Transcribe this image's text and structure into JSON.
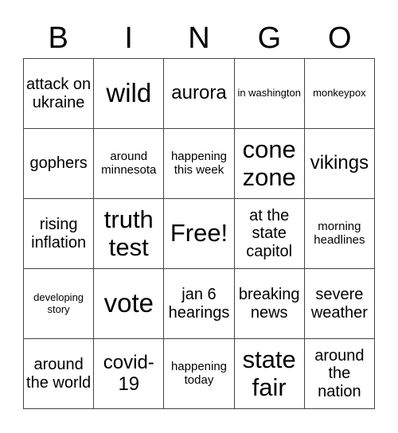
{
  "header": {
    "letters": [
      "B",
      "I",
      "N",
      "G",
      "O"
    ]
  },
  "board": {
    "rows": [
      [
        {
          "text": "attack on ukraine",
          "size": "md"
        },
        {
          "text": "wild",
          "size": "xxl"
        },
        {
          "text": "aurora",
          "size": "lg"
        },
        {
          "text": "in washington",
          "size": "xs"
        },
        {
          "text": "monkeypox",
          "size": "xs"
        }
      ],
      [
        {
          "text": "gophers",
          "size": "md"
        },
        {
          "text": "around minnesota",
          "size": "sm"
        },
        {
          "text": "happening this week",
          "size": "sm"
        },
        {
          "text": "cone zone",
          "size": "xl"
        },
        {
          "text": "vikings",
          "size": "lg"
        }
      ],
      [
        {
          "text": "rising inflation",
          "size": "md"
        },
        {
          "text": "truth test",
          "size": "xl"
        },
        {
          "text": "Free!",
          "size": "xl"
        },
        {
          "text": "at the state capitol",
          "size": "md"
        },
        {
          "text": "morning headlines",
          "size": "sm"
        }
      ],
      [
        {
          "text": "developing story",
          "size": "xs"
        },
        {
          "text": "vote",
          "size": "xxl"
        },
        {
          "text": "jan 6 hearings",
          "size": "md"
        },
        {
          "text": "breaking news",
          "size": "md"
        },
        {
          "text": "severe weather",
          "size": "md"
        }
      ],
      [
        {
          "text": "around the world",
          "size": "md"
        },
        {
          "text": "covid-19",
          "size": "lg"
        },
        {
          "text": "happening today",
          "size": "sm"
        },
        {
          "text": "state fair",
          "size": "xl"
        },
        {
          "text": "around the nation",
          "size": "md"
        }
      ]
    ]
  }
}
